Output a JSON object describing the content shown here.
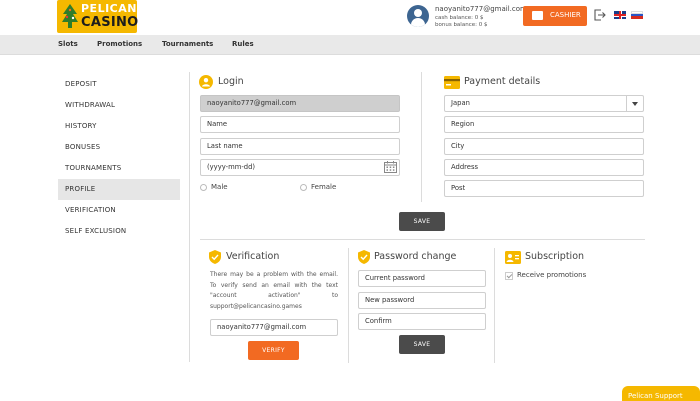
{
  "logo": {
    "line1": "PELICAN",
    "line2": "CASINO"
  },
  "user": {
    "email": "naoyanito777@gmail.com",
    "cash_balance": "cash balance: 0 $",
    "bonus_balance": "bonus balance: 0 $"
  },
  "header": {
    "cashier_label": "CASHIER"
  },
  "nav": {
    "items": [
      "Slots",
      "Promotions",
      "Tournaments",
      "Rules"
    ]
  },
  "sidebar": {
    "items": [
      "DEPOSIT",
      "WITHDRAWAL",
      "HISTORY",
      "BONUSES",
      "TOURNAMENTS",
      "PROFILE",
      "VERIFICATION",
      "SELF EXCLUSION"
    ],
    "active": "PROFILE"
  },
  "login": {
    "title": "Login",
    "email_value": "naoyanito777@gmail.com",
    "name_placeholder": "Name",
    "lastname_placeholder": "Last name",
    "dob_placeholder": "(yyyy-mm-dd)",
    "gender_male": "Male",
    "gender_female": "Female"
  },
  "payment": {
    "title": "Payment details",
    "country_value": "Japan",
    "region_placeholder": "Region",
    "city_placeholder": "City",
    "address_placeholder": "Address",
    "post_placeholder": "Post"
  },
  "save_label": "SAVE",
  "verification": {
    "title": "Verification",
    "text": "There may be a problem with the email. To verify send an email with the text \"account activation\" to support@pelicancasino.games",
    "email_value": "naoyanito777@gmail.com",
    "verify_label": "VERIFY"
  },
  "password": {
    "title": "Password change",
    "current_placeholder": "Current password",
    "new_placeholder": "New password",
    "confirm_placeholder": "Confirm",
    "save_label": "SAVE"
  },
  "subscription": {
    "title": "Subscription",
    "receive_label": "Receive promotions"
  },
  "support": {
    "label": "Pelican Support"
  },
  "colors": {
    "accent": "#f26a22",
    "brand": "#f5b800",
    "dark_button": "#4b4b4b"
  }
}
